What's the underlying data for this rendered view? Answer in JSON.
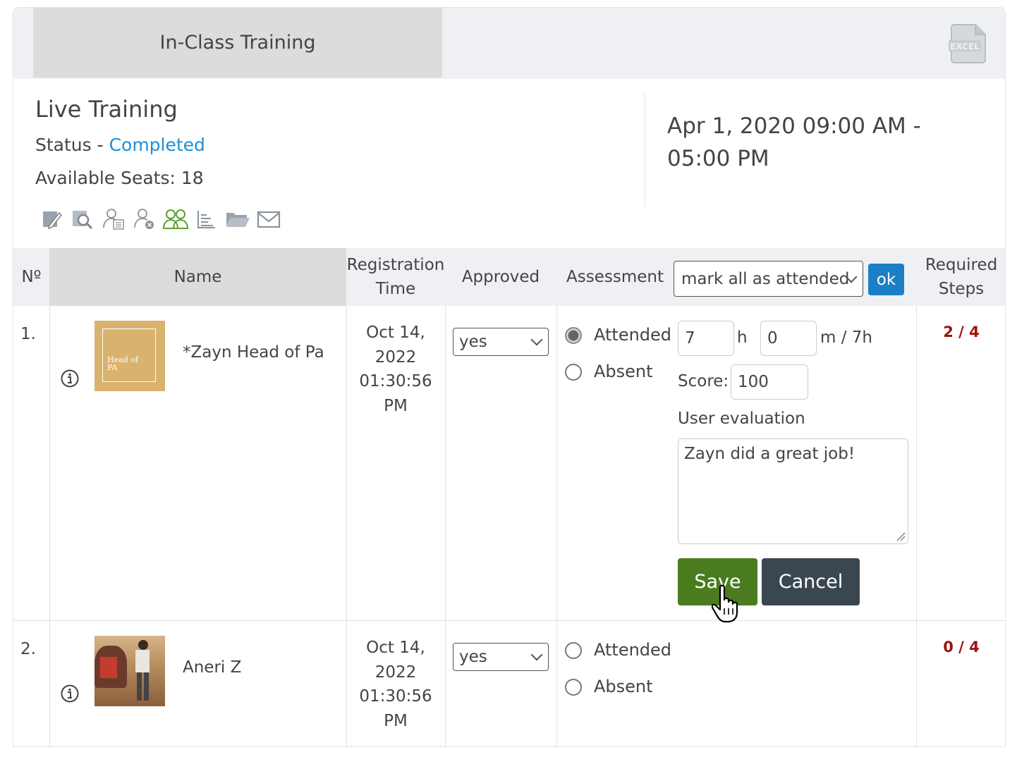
{
  "header": {
    "tab_label": "In-Class Training",
    "excel_icon_text": "EXCEL"
  },
  "session": {
    "title": "Live Training",
    "status_label": "Status - ",
    "status_value": "Completed",
    "seats": "Available Seats: 18",
    "date_range": "Apr 1, 2020 09:00 AM - 05:00 PM"
  },
  "toolbar": [
    "edit-icon",
    "preview-icon",
    "user-list-icon",
    "remove-user-icon",
    "users-group-icon",
    "report-icon",
    "folder-icon",
    "email-icon"
  ],
  "table": {
    "headers": {
      "no": "Nº",
      "name": "Name",
      "registration": "Registration Time",
      "approved": "Approved",
      "assessment": "Assessment",
      "required": "Required Steps"
    },
    "bulk_select": "mark all as attended",
    "ok_label": "ok",
    "rows": [
      {
        "no": "1.",
        "name": "*Zayn Head of Pa",
        "avatar_text": "Head of PA",
        "reg_date": "Oct 14,",
        "reg_year": "2022",
        "reg_time": "01:30:56",
        "reg_ampm": "PM",
        "approved": "yes",
        "attended_label": "Attended",
        "absent_label": "Absent",
        "hours": "7",
        "h_label": "h",
        "minutes": "0",
        "m_label": "m / 7h",
        "score_label": "Score:",
        "score": "100",
        "eval_label": "User evaluation",
        "evaluation": "Zayn did a great job!",
        "save_label": "Save",
        "cancel_label": "Cancel",
        "steps": "2 / 4"
      },
      {
        "no": "2.",
        "name": "Aneri Z",
        "reg_date": "Oct 14,",
        "reg_year": "2022",
        "reg_time": "01:30:56",
        "reg_ampm": "PM",
        "approved": "yes",
        "attended_label": "Attended",
        "absent_label": "Absent",
        "steps": "0 / 4"
      }
    ]
  },
  "colors": {
    "link": "#1b8fd6",
    "ok_button": "#1a7fc4",
    "save_button": "#4a7c1f",
    "cancel_button": "#3a4751",
    "steps_text": "#a01010"
  }
}
